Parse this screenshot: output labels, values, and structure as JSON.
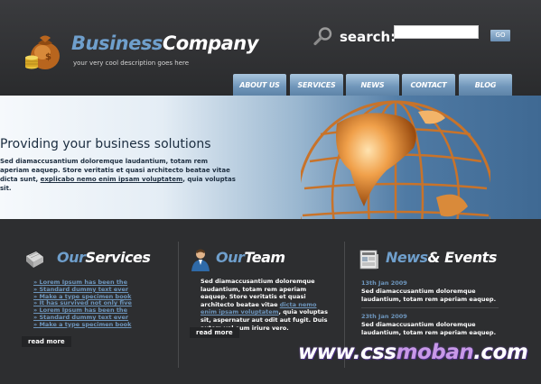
{
  "header": {
    "brand_word1": "Business",
    "brand_word2": "Company",
    "tagline": "your very cool description goes here",
    "logo_icon": "money-bag-icon",
    "search_label": "search:",
    "search_value": "",
    "search_button": "GO"
  },
  "nav": {
    "items": [
      {
        "label": "ABOUT US"
      },
      {
        "label": "SERVICES"
      },
      {
        "label": "NEWS"
      },
      {
        "label": "CONTACT"
      },
      {
        "label": "BLOG"
      }
    ]
  },
  "banner": {
    "title": "Providing your business solutions",
    "text_before": "Sed diamaccusantium doloremque laudantium, totam rem aperiam eaquep. Store veritatis et quasi architecto beatae vitae dicta sunt, ",
    "link": "explicabo nemo enim ipsam voluptatem",
    "text_after": ", quia voluptas sit."
  },
  "services": {
    "title_word1": "Our",
    "title_word2": "Services",
    "items": [
      "» Lorem Ipsum has been the",
      "» Standard dummy text ever",
      "» Make a type specimen book",
      "» It has survived not only five",
      "» Lorem Ipsum has been the",
      "» Standard dummy text ever",
      "» Make a type specimen book"
    ],
    "read_more": "read more"
  },
  "team": {
    "title_word1": "Our",
    "title_word2": "Team",
    "text_before": "Sed diamaccusantium doloremque laudantium, totam rem aperiam eaquep. Store veritatis et quasi architecto beatae vitae ",
    "link": "dicta nemo enim ipsam voluptatem",
    "text_after": ", quia voluptas sit, aspernatur aut odit aut fugit. Duis autem vel eum iriure vero.",
    "read_more": "read more"
  },
  "news": {
    "title_word1": "News",
    "title_word2": "& Events",
    "items": [
      {
        "date": "13th Jan 2009",
        "text": "Sed diamaccusantium doloremque laudantium, totam rem aperiam eaquep."
      },
      {
        "date": "23th Jan 2009",
        "text": "Sed diamaccusantium doloremque laudantium, totam rem aperiam eaquep."
      }
    ]
  },
  "watermark": {
    "part1": "www.css",
    "part2": "moban",
    "part3": ".com"
  },
  "colors": {
    "accent": "#6f9fcc",
    "background": "#2b2c2e",
    "nav_tab": "#7b9fc2"
  }
}
